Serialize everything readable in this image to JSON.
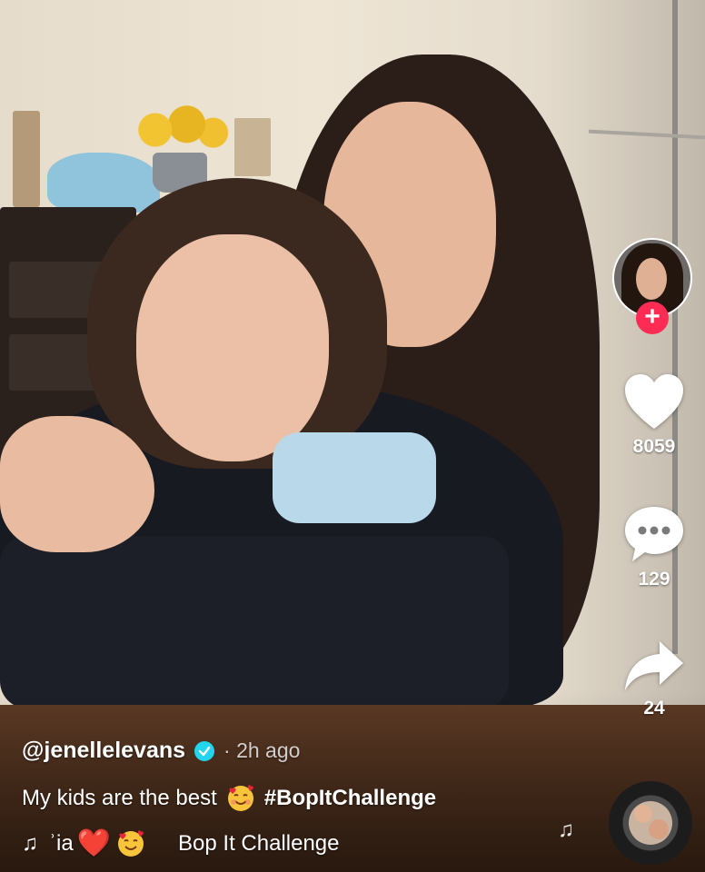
{
  "post": {
    "username": "@jenellelevans",
    "verified": true,
    "meta": "· 2h ago",
    "description_text": "My kids are the best",
    "description_emoji": "smiling-face-with-hearts",
    "hashtag": "#BopItChallenge"
  },
  "music": {
    "note": "♫",
    "credit_partial": "ʾia",
    "heart": "❤️",
    "emoji": "smiling-face-with-hearts",
    "title": "Bop It Challenge"
  },
  "actions": {
    "follow_label": "+",
    "likes": "8059",
    "comments": "129",
    "shares": "24"
  },
  "colors": {
    "follow_accent": "#fe2c55",
    "verified_badge": "#20d5ec",
    "icon_fill": "#ffffff"
  },
  "floating_note": "♫"
}
